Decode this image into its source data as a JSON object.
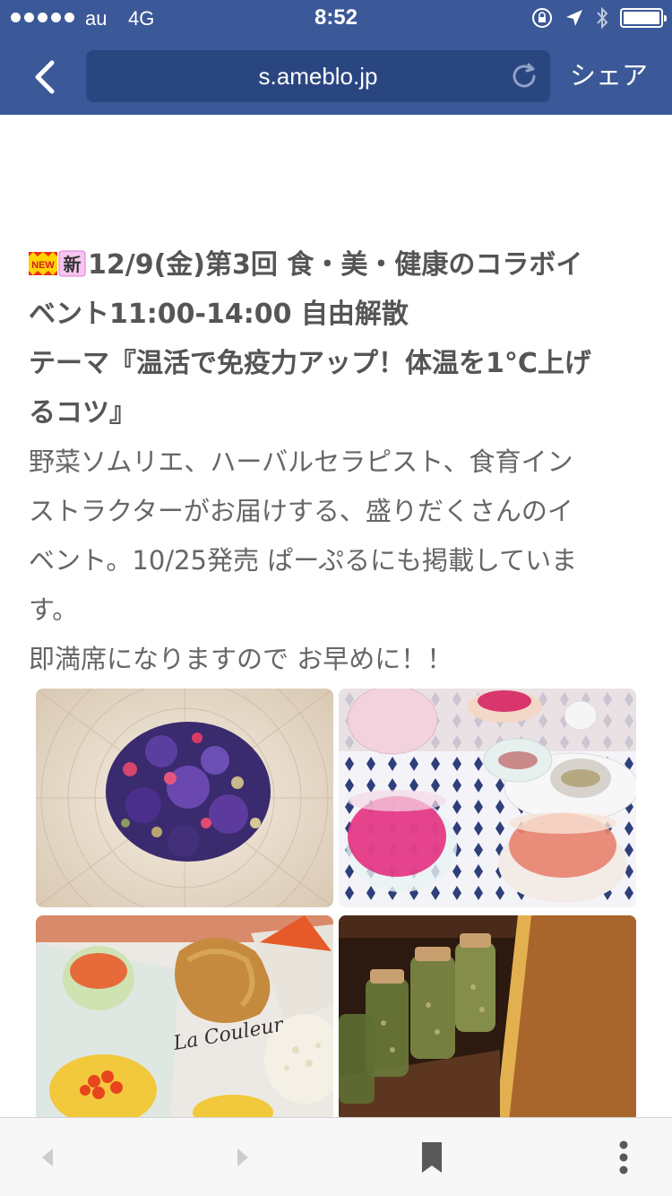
{
  "status_bar": {
    "carrier": "au",
    "network": "4G",
    "time": "8:52",
    "icons": [
      "orientation-lock-icon",
      "location-arrow-icon",
      "bluetooth-icon",
      "battery-icon"
    ]
  },
  "nav": {
    "url": "s.ameblo.jp",
    "share_label": "シェア"
  },
  "article": {
    "badges": [
      "NEW",
      "新"
    ],
    "heading_lines": [
      "12/9(金)第3回 食・美・健康のコラボイ",
      "ベント11:00-14:00 自由解散",
      "テーマ『温活で免疫力アップ！体温を1°C上げ",
      "るコツ』"
    ],
    "body_lines": [
      "野菜ソムリエ、ハーバルセラピスト、食育イン",
      "ストラクターがお届けする、盛りだくさんのイ",
      "ベント。10/25発売 ぱーぷるにも掲載していま",
      "す。",
      "即満席になりますので お早めに！！"
    ],
    "photo_caption_text": "La Couleur"
  },
  "colors": {
    "bar_blue": "#3b5998",
    "url_field": "#2a4681",
    "heading_text": "#555555",
    "body_text": "#666666"
  },
  "toolbar": {
    "icons": [
      "back-arrow-icon",
      "forward-arrow-icon",
      "bookmark-icon",
      "more-options-icon"
    ]
  }
}
